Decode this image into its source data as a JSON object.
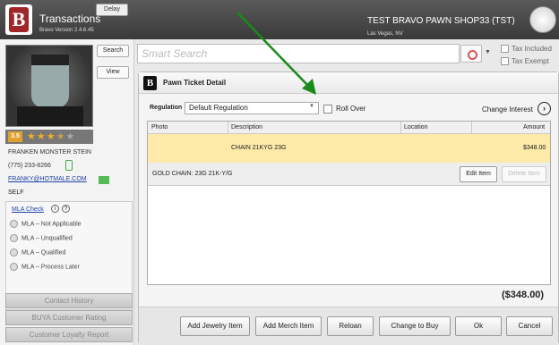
{
  "header": {
    "title": "Transactions",
    "version": "Bravo Version 2.4.6.45",
    "delay_label": "Delay",
    "shop_name": "TEST BRAVO PAWN SHOP33 (TST)",
    "shop_location": "Las Vegas, NV"
  },
  "customer": {
    "search_label": "Search",
    "view_label": "View",
    "rating": "3.5",
    "stars_filled": "★★★",
    "stars_half": "★",
    "stars_empty": "★",
    "name": "FRANKEN MONSTER STEIN",
    "phone": "(775) 233-8266",
    "email": "FRANKY@HOTMALE.COM",
    "relation": "SELF",
    "mla_check_label": "MLA Check",
    "mla_options": [
      "MLA – Not Applicable",
      "MLA – Unqualified",
      "MLA – Qualified",
      "MLA – Process Later"
    ],
    "bottom_buttons": [
      "Contact History",
      "BUYA Customer Rating",
      "Customer Loyalty Report"
    ]
  },
  "search": {
    "placeholder": "Smart Search",
    "tax_included": "Tax Included",
    "tax_exempt": "Tax Exempt"
  },
  "dialog": {
    "title": "Pawn Ticket Detail",
    "regulation_label": "Regulation",
    "regulation_value": "Default Regulation",
    "rollover_label": "Roll Over",
    "change_interest": "Change Interest",
    "columns": [
      "Photo",
      "Description",
      "Location",
      "Amount"
    ],
    "row": {
      "description": "CHAIN 21KYG 23G",
      "amount": "$348.00"
    },
    "sub_description": "GOLD CHAIN: 23G 21K-Y/G",
    "edit_item": "Edit Item",
    "delete_item": "Delete Item",
    "total": "($348.00)",
    "actions": [
      "Add Jewelry Item",
      "Add Merch Item",
      "Reloan",
      "Change to Buy",
      "Ok",
      "Cancel"
    ]
  },
  "colors": {
    "selected_row": "#fde9a8",
    "brand_red": "#a0262a",
    "annotation_arrow": "#1a8a1a"
  }
}
